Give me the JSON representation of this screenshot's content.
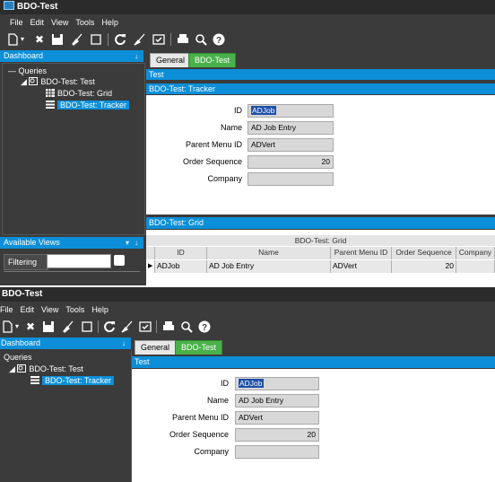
{
  "app": {
    "title": "BDO-Test"
  },
  "menu": [
    "File",
    "Edit",
    "View",
    "Tools",
    "Help"
  ],
  "toolbar_icons": [
    "new-icon",
    "dropdown-icon",
    "delete-icon",
    "save-icon",
    "clear-icon",
    "blank-icon",
    "refresh-icon",
    "eraser-icon",
    "check-icon",
    "print-icon",
    "print-preview-icon",
    "help-icon"
  ],
  "dashboard": {
    "title": "Dashboard",
    "pin": "↓",
    "tree": {
      "root": "Queries",
      "query": "BDO-Test: Test",
      "grid": "BDO-Test: Grid",
      "tracker": "BDO-Test: Tracker"
    }
  },
  "available_views": {
    "title": "Available Views",
    "filter_label": "Filtering"
  },
  "tabs": [
    {
      "label": "General"
    },
    {
      "label": "BDO-Test"
    }
  ],
  "sections": {
    "test": "Test",
    "tracker": "BDO-Test: Tracker",
    "grid": "BDO-Test: Grid"
  },
  "form": {
    "id_label": "ID",
    "id_value": "ADJob",
    "name_label": "Name",
    "name_value": "AD Job Entry",
    "parent_label": "Parent Menu ID",
    "parent_value": "ADVert",
    "order_label": "Order Sequence",
    "order_value": "20",
    "company_label": "Company",
    "company_value": ""
  },
  "grid": {
    "caption": "BDO-Test: Grid",
    "columns": [
      "ID",
      "Name",
      "Parent Menu ID",
      "Order Sequence",
      "Company"
    ],
    "row": {
      "pointer": "▶",
      "id": "ADJob",
      "name": "AD Job Entry",
      "parent": "ADVert",
      "order": "20",
      "company": ""
    }
  },
  "colors": {
    "accent": "#0c8fd8",
    "tab_active": "#4ab14a",
    "chrome": "#3b3b3b",
    "field": "#d8d8d8",
    "selection": "#1e4fa8"
  }
}
